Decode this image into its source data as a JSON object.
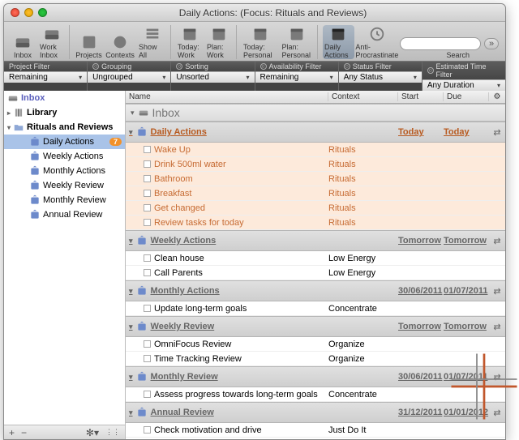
{
  "window_title": "Daily Actions:  (Focus: Rituals and Reviews)",
  "toolbar": {
    "inbox": "Inbox",
    "work_inbox": "Work Inbox",
    "projects": "Projects",
    "contexts": "Contexts",
    "show_all": "Show All",
    "today_work": "Today: Work",
    "plan_work": "Plan: Work",
    "today_personal": "Today: Personal",
    "plan_personal": "Plan: Personal",
    "daily_actions": "Daily Actions",
    "anti_procrastinate": "Anti-Procrastinate",
    "search": "Search"
  },
  "filters": {
    "project": {
      "label": "Project Filter",
      "value": "Remaining"
    },
    "grouping": {
      "label": "Grouping",
      "value": "Ungrouped"
    },
    "sorting": {
      "label": "Sorting",
      "value": "Unsorted"
    },
    "availability": {
      "label": "Availability Filter",
      "value": "Remaining"
    },
    "status": {
      "label": "Status Filter",
      "value": "Any Status"
    },
    "duration": {
      "label": "Estimated Time Filter",
      "value": "Any Duration"
    }
  },
  "sidebar": {
    "inbox": "Inbox",
    "library": "Library",
    "folder": "Rituals and Reviews",
    "items": [
      {
        "label": "Daily Actions",
        "badge": "7"
      },
      {
        "label": "Weekly Actions"
      },
      {
        "label": "Monthly Actions"
      },
      {
        "label": "Weekly Review"
      },
      {
        "label": "Monthly Review"
      },
      {
        "label": "Annual Review"
      }
    ]
  },
  "columns": {
    "name": "Name",
    "context": "Context",
    "start": "Start",
    "due": "Due"
  },
  "inbox_label": "Inbox",
  "groups": [
    {
      "name": "Daily Actions",
      "hot": true,
      "start": "Today",
      "due": "Today",
      "tasks": [
        {
          "name": "Wake Up",
          "context": "Rituals"
        },
        {
          "name": "Drink 500ml water",
          "context": "Rituals"
        },
        {
          "name": "Bathroom",
          "context": "Rituals"
        },
        {
          "name": "Breakfast",
          "context": "Rituals"
        },
        {
          "name": "Get changed",
          "context": "Rituals"
        },
        {
          "name": "Review tasks for today",
          "context": "Rituals"
        }
      ]
    },
    {
      "name": "Weekly Actions",
      "start": "Tomorrow",
      "due": "Tomorrow",
      "tasks": [
        {
          "name": "Clean house",
          "context": "Low Energy"
        },
        {
          "name": "Call Parents",
          "context": "Low Energy"
        }
      ]
    },
    {
      "name": "Monthly Actions",
      "start": "30/06/2011",
      "due": "01/07/2011",
      "tasks": [
        {
          "name": "Update long-term goals",
          "context": "Concentrate"
        }
      ]
    },
    {
      "name": "Weekly Review",
      "start": "Tomorrow",
      "due": "Tomorrow",
      "tasks": [
        {
          "name": "OmniFocus Review",
          "context": "Organize"
        },
        {
          "name": "Time Tracking Review",
          "context": "Organize"
        }
      ]
    },
    {
      "name": "Monthly Review",
      "start": "30/06/2011",
      "due": "01/07/2011",
      "tasks": [
        {
          "name": "Assess progress towards long-term goals",
          "context": "Concentrate"
        }
      ]
    },
    {
      "name": "Annual Review",
      "start": "31/12/2011",
      "due": "01/01/2012",
      "tasks": [
        {
          "name": "Check motivation and drive",
          "context": "Just Do It"
        }
      ]
    }
  ]
}
